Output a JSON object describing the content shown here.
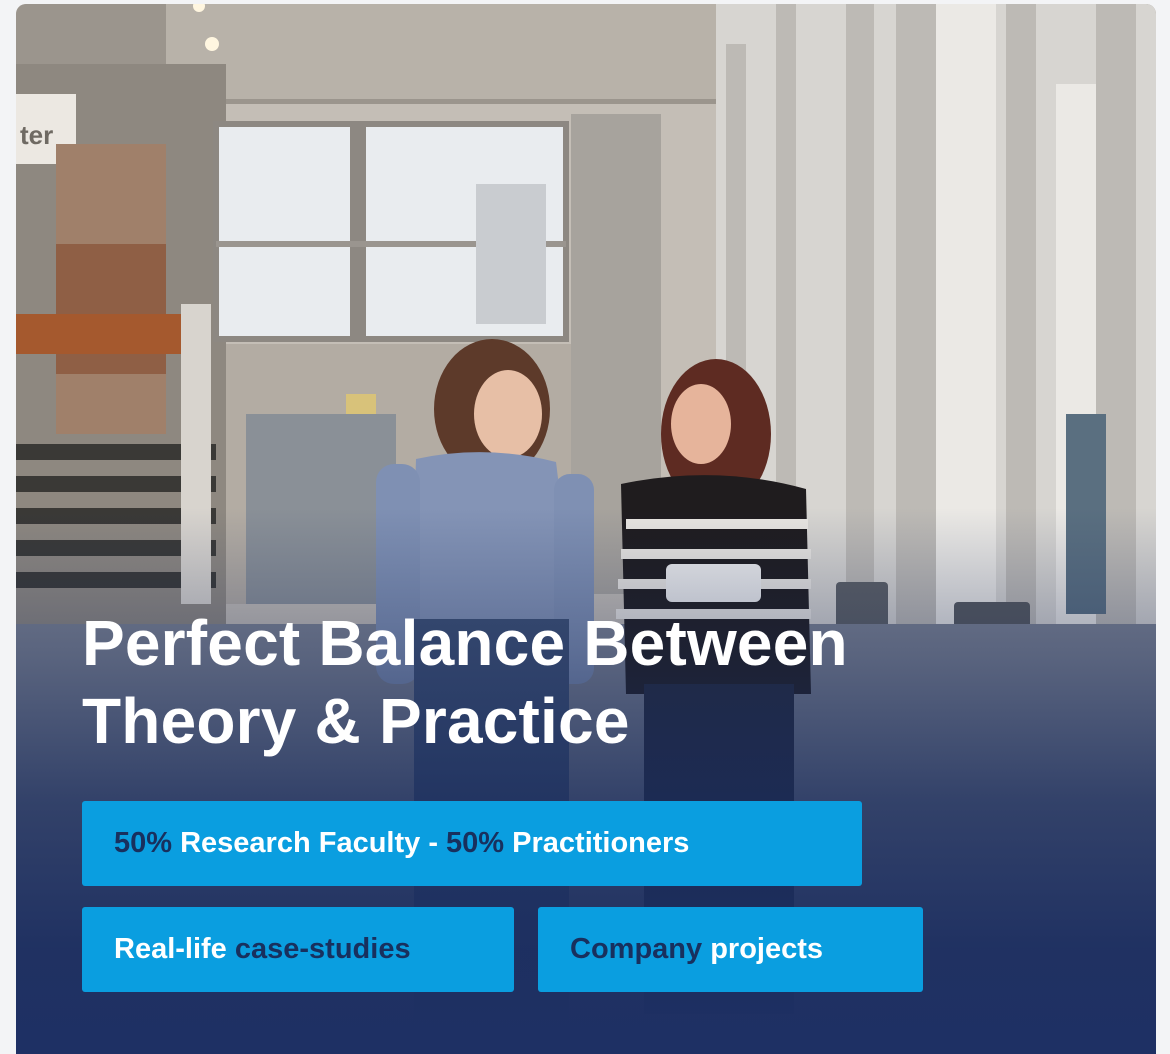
{
  "hero": {
    "title_line1": "Perfect Balance Between",
    "title_line2": "Theory & Practice",
    "photo_sign_text": "ter",
    "photo_alt": "two students walking through a university building"
  },
  "highlights": [
    {
      "part1": "50%",
      "part2": " Research Faculty - ",
      "part3": "50%",
      "part4": " Practitioners"
    },
    {
      "part1": "Real-life ",
      "part2": "case-studies"
    },
    {
      "part1": "Company",
      "part2": " projects"
    }
  ],
  "colors": {
    "pill_bg": "#0a9ee0",
    "pill_accent_text": "#18305e",
    "overlay_navy": "#1e3064",
    "title_text": "#ffffff"
  }
}
